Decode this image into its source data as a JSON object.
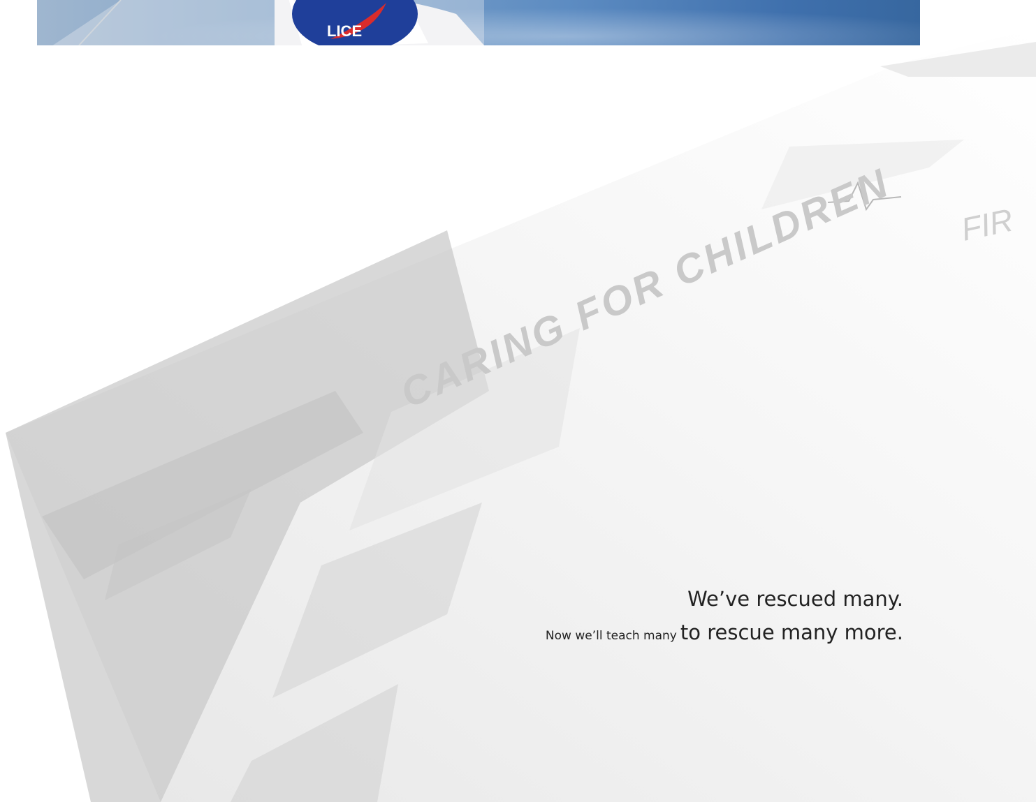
{
  "hero": {
    "flag_text": "LICE"
  },
  "collage": {
    "headline": "CARING FOR CHILDREN",
    "side_text": "FIR"
  },
  "tagline": {
    "line1": "We’ve rescued many.",
    "line2_small": "Now we’ll teach many",
    "line2_large": "to rescue many more"
  },
  "colors": {
    "sky_light": "#9fb6cf",
    "sky_dark": "#37679f",
    "collage_gray": "#d9d9d9",
    "text": "#222222"
  }
}
